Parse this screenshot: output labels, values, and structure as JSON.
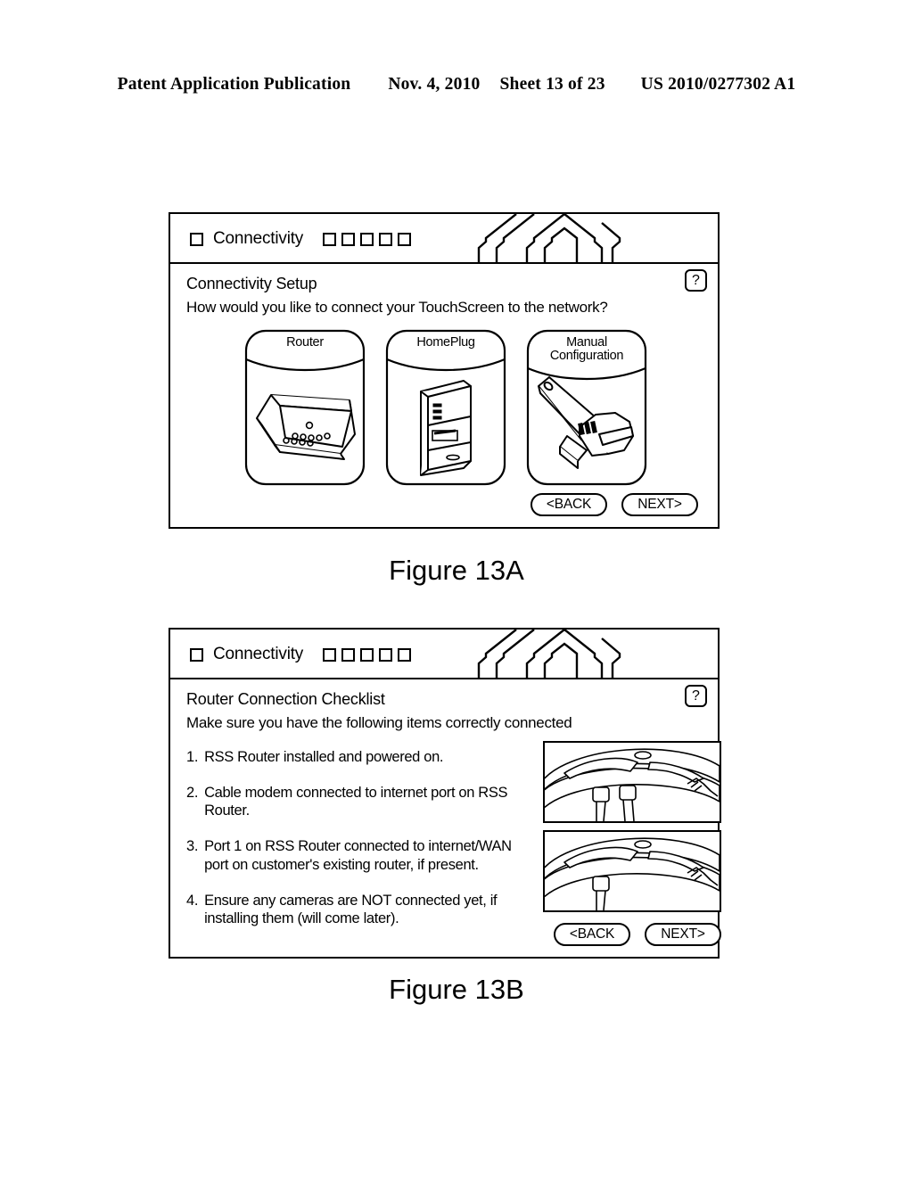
{
  "patent_header": {
    "publication": "Patent Application Publication",
    "date": "Nov. 4, 2010",
    "sheet": "Sheet 13 of 23",
    "number": "US 2010/0277302 A1"
  },
  "figures": [
    {
      "caption": "Figure 13A",
      "titlebar": {
        "checkbox_icon": "checkbox-empty-icon",
        "label": "Connectivity",
        "step_count": 5,
        "logo_icon": "house-chevron-logo-icon"
      },
      "panel": {
        "title": "Connectivity Setup",
        "subtitle": "How would you like to connect your TouchScreen to the network?",
        "help_label": "?"
      },
      "options": [
        {
          "label": "Router",
          "art_icon": "router-device-icon"
        },
        {
          "label": "HomePlug",
          "art_icon": "homeplug-adapter-icon"
        },
        {
          "label": "Manual\nConfiguration",
          "art_icon": "wrench-icon"
        }
      ],
      "nav": {
        "back": "<BACK",
        "next": "NEXT>"
      }
    },
    {
      "caption": "Figure 13B",
      "titlebar": {
        "checkbox_icon": "checkbox-empty-icon",
        "label": "Connectivity",
        "step_count": 5,
        "logo_icon": "house-chevron-logo-icon"
      },
      "panel": {
        "title": "Router Connection Checklist",
        "subtitle": "Make sure you have the following items correctly connected",
        "help_label": "?"
      },
      "checklist": [
        {
          "num": "1.",
          "text": "RSS Router installed and powered on."
        },
        {
          "num": "2.",
          "text": "Cable modem connected to internet port on RSS Router."
        },
        {
          "num": "3.",
          "text": "Port 1 on RSS Router connected to internet/WAN port on customer's existing router, if present."
        },
        {
          "num": "4.",
          "text": "Ensure any cameras are NOT connected yet, if installing them (will come later)."
        }
      ],
      "photos": [
        {
          "alt_icon": "router-rear-two-cables-photo-icon"
        },
        {
          "alt_icon": "router-rear-one-cable-photo-icon"
        }
      ],
      "nav": {
        "back": "<BACK",
        "next": "NEXT>"
      }
    }
  ],
  "colors": {
    "ink": "#000000",
    "paper": "#ffffff"
  }
}
